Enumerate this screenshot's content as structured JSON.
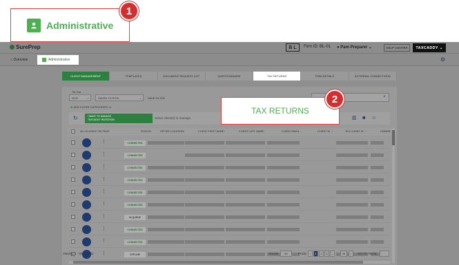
{
  "annotations": {
    "step1": {
      "number": "1",
      "label": "Administrative"
    },
    "step2": {
      "number": "2",
      "label": "TAX RETURNS"
    }
  },
  "header": {
    "logo": "SurePrep",
    "firm_badge": "B L",
    "firm_id": "Firm ID: BL-01",
    "user": "Pam Preparer",
    "help": "HELP CENTER",
    "taxcaddy": "TAXCADDY"
  },
  "nav": {
    "overview": "Overview",
    "admin": "Administrative"
  },
  "tabs": [
    {
      "label": "CLIENT MANAGEMENT",
      "state": "active"
    },
    {
      "label": "TEMPLATES",
      "state": ""
    },
    {
      "label": "DOCUMENT REQUEST LIST",
      "state": ""
    },
    {
      "label": "QUESTIONNAIRE",
      "state": ""
    },
    {
      "label": "TAX RETURNS",
      "state": "sel"
    },
    {
      "label": "FIRM DETAILS",
      "state": ""
    },
    {
      "label": "EXTERNAL CONNECTIONS",
      "state": ""
    }
  ],
  "filters": {
    "tax_year_label": "Tax Year",
    "tax_year_value": "2020",
    "saved_filters": "SAVED FILTERS",
    "save_filter": "SAVE FILTER",
    "add_filter": "ADD FILTER CATEGORIES"
  },
  "actionbar": {
    "manage_line1": "I WANT TO MANAGE",
    "manage_line2": "TAXCADDY INVITATION",
    "select_placeholder": "Select client(s) to manage."
  },
  "table": {
    "columns": [
      "ALL ELIGIBLE ON PAGE",
      "STATUS",
      "OFFICE LOCATION",
      "CLIENT FIRST NAME",
      "CLIENT LAST NAME",
      "CLIENT EMAIL",
      "CLIENT ID",
      "TAX CLIENT ID",
      "OWNER"
    ],
    "rows": [
      {
        "status": "CONNECTED",
        "style": "green"
      },
      {
        "status": "CONNECTED",
        "style": "green"
      },
      {
        "status": "CONNECTED",
        "style": "green"
      },
      {
        "status": "CONNECTED",
        "style": "green"
      },
      {
        "status": "CONNECTED",
        "style": "green"
      },
      {
        "status": "CONNECTED",
        "style": "green"
      },
      {
        "status": "IN QUEUE",
        "style": "gray"
      },
      {
        "status": "CONNECTED",
        "style": "green"
      },
      {
        "status": "CONNECTED",
        "style": "green"
      },
      {
        "status": "OFFLINE",
        "style": "gray"
      }
    ]
  },
  "footer": {
    "viewing": "Viewing 1 - 50 of 4742",
    "show_label": "SHOW",
    "show_value": "50",
    "page_label": "PAGE",
    "pages": [
      "1",
      "2",
      "3",
      "...",
      "95"
    ],
    "goto": "GO TO PAGE"
  }
}
